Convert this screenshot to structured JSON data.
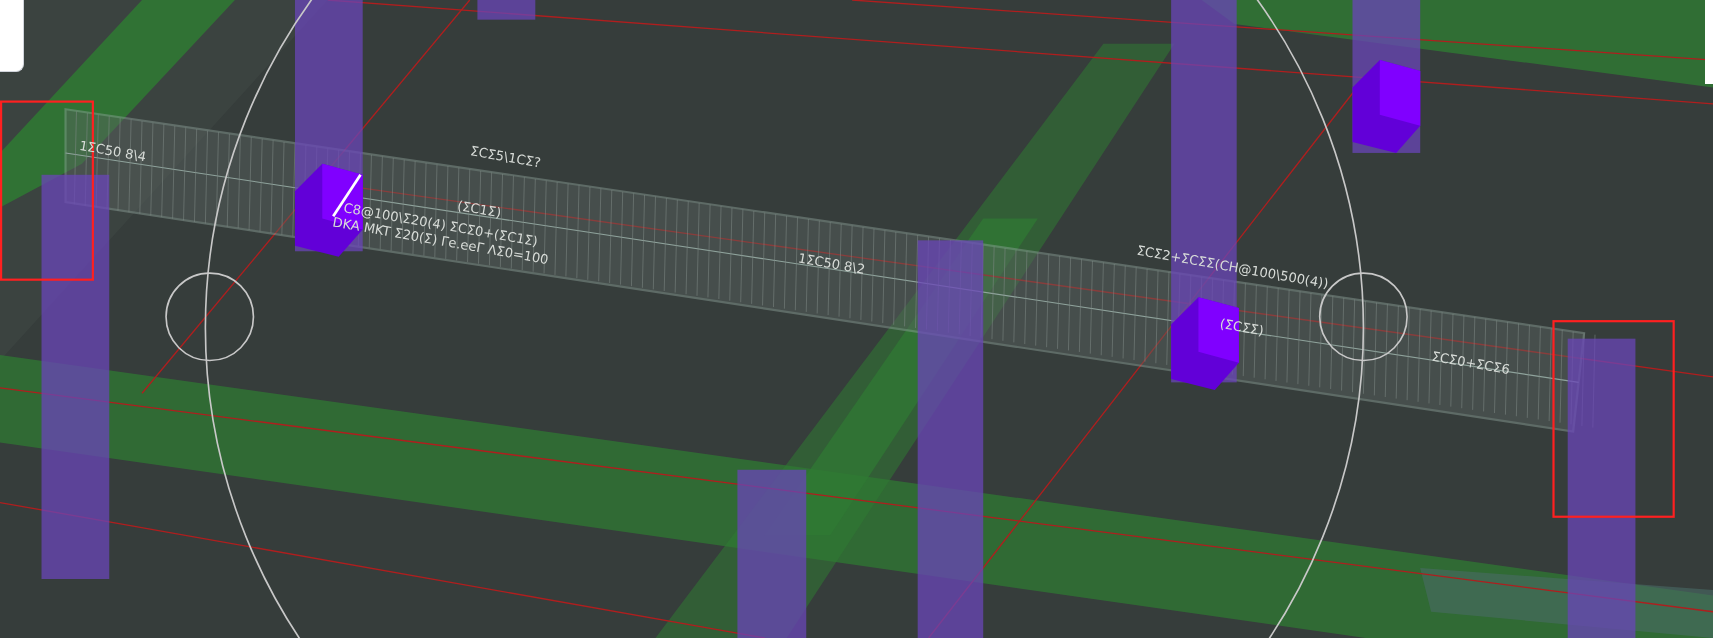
{
  "viewport": {
    "annotations": [
      {
        "text": "1ΣC50 8\\4"
      },
      {
        "text": "ΣCΣ5\\1CΣ?"
      },
      {
        "text": "(ΣC1Σ)"
      },
      {
        "text": "C8@100\\Σ20(4) ΣCΣ0+(ΣC1Σ)"
      },
      {
        "text": "DKA MKT Σ20(Σ) Γe.eeΓ ΛΣ0=100"
      },
      {
        "text": "1ΣC50 8\\2"
      },
      {
        "text": "ΣCΣ2+ΣCΣΣ(CH@100\\500(4))"
      },
      {
        "text": "(ΣCΣΣ)"
      },
      {
        "text": "ΣCΣ0+ΣCΣ6"
      }
    ]
  }
}
